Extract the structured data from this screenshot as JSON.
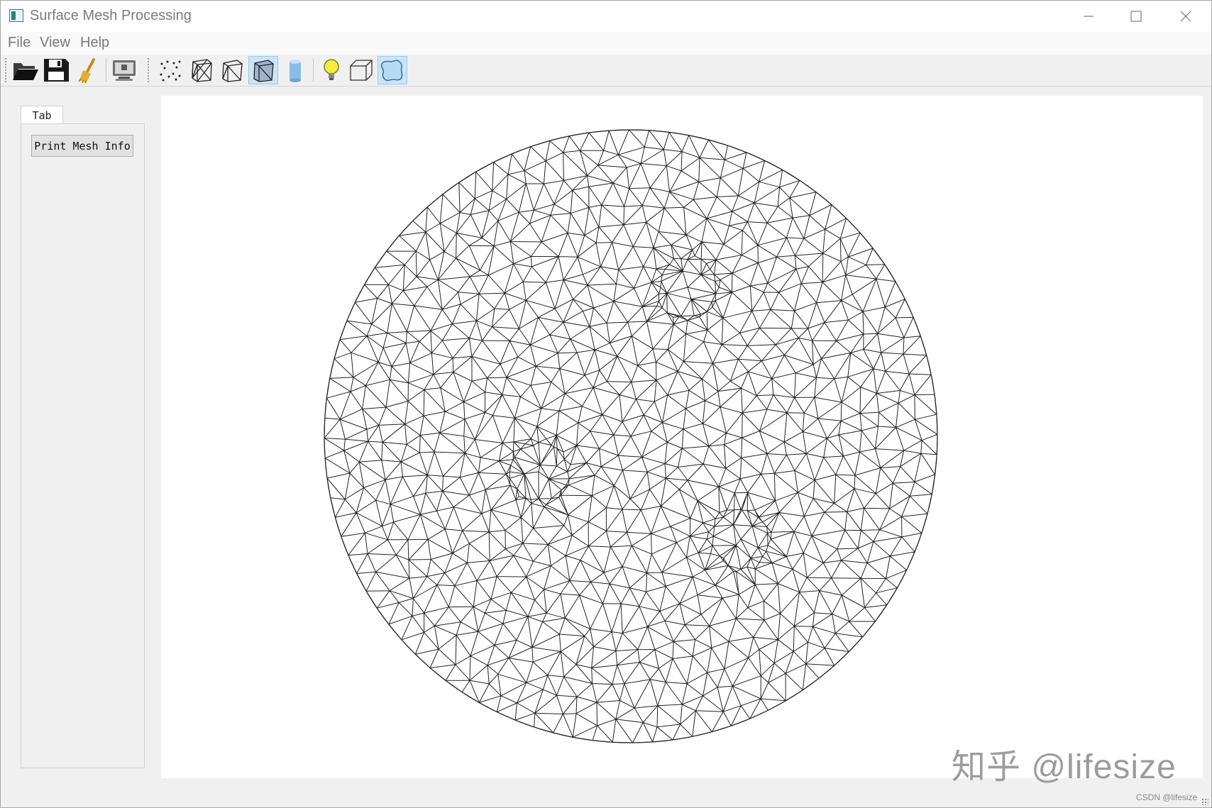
{
  "window": {
    "title": "Surface Mesh Processing"
  },
  "menu": {
    "items": [
      "File",
      "View",
      "Help"
    ]
  },
  "toolbar": {
    "buttons": [
      {
        "icon": "open-folder-icon",
        "checked": false
      },
      {
        "icon": "save-disk-icon",
        "checked": false
      },
      {
        "icon": "clean-brush-icon",
        "checked": false
      },
      {
        "icon": "screen-capture-icon",
        "checked": false
      },
      {
        "icon": "points-mode-icon",
        "checked": false
      },
      {
        "icon": "wireframe-mode-icon",
        "checked": false
      },
      {
        "icon": "hidden-lines-mode-icon",
        "checked": false
      },
      {
        "icon": "flat-lines-mode-icon",
        "checked": true
      },
      {
        "icon": "flat-mode-icon",
        "checked": false
      },
      {
        "icon": "lighting-bulb-icon",
        "checked": false
      },
      {
        "icon": "bounding-box-icon",
        "checked": false
      },
      {
        "icon": "boundary-edges-icon",
        "checked": true
      }
    ]
  },
  "left_panel": {
    "tab_label": "Tab",
    "print_button_label": "Print Mesh Info"
  },
  "viewport": {
    "mesh": "disk-triangulation",
    "background": "#ffffff",
    "line_color": "#222222",
    "watermark": "知乎 @lifesize",
    "credit": "CSDN @lifesize"
  },
  "colors": {
    "checked_button_bg": "#cce4f7",
    "checked_button_border": "#99c9ef"
  }
}
